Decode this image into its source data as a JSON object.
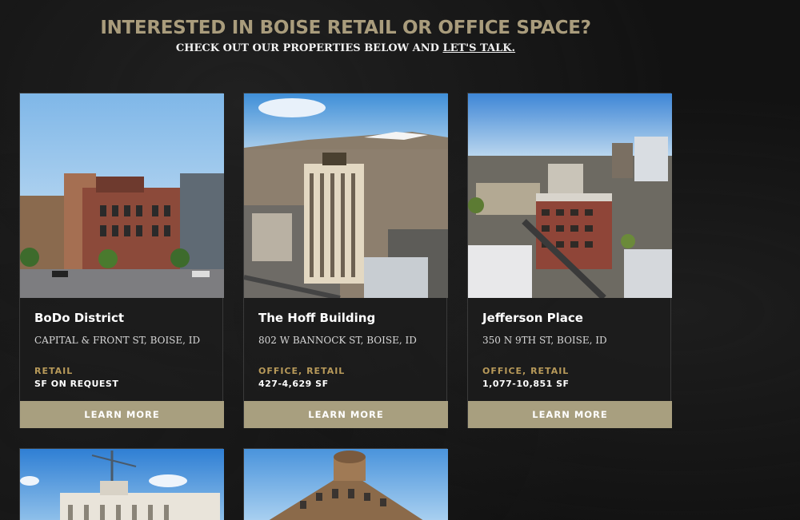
{
  "header": {
    "headline": "INTERESTED IN BOISE RETAIL OR OFFICE SPACE?",
    "subline_prefix": "CHECK OUT OUR PROPERTIES BELOW AND ",
    "subline_link": "LET'S TALK."
  },
  "properties": [
    {
      "name": "BoDo District",
      "address": "CAPITAL & FRONT ST, BOISE, ID",
      "use": "RETAIL",
      "size": "SF ON REQUEST",
      "button": "LEARN MORE"
    },
    {
      "name": "The Hoff Building",
      "address": "802 W BANNOCK ST, BOISE, ID",
      "use": "OFFICE, RETAIL",
      "size": "427-4,629 SF",
      "button": "LEARN MORE"
    },
    {
      "name": "Jefferson Place",
      "address": "350 N 9TH ST, BOISE, ID",
      "use": "OFFICE, RETAIL",
      "size": "1,077-10,851 SF",
      "button": "LEARN MORE"
    }
  ],
  "colors": {
    "accent": "#a99c7c",
    "button": "#a89f7f",
    "use_label": "#b89a5a",
    "background": "#121212"
  }
}
